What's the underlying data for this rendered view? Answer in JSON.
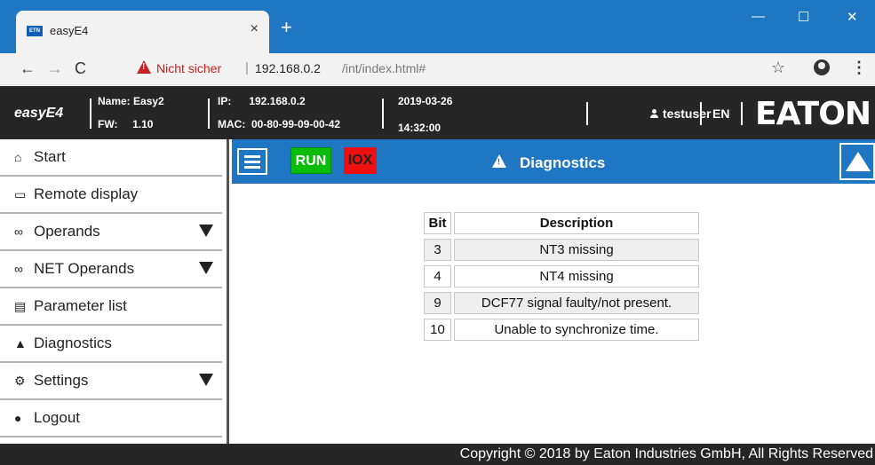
{
  "browser": {
    "tab_title": "easyE4",
    "tab_favicon_text": "ETN",
    "tab_close": "×",
    "new_tab": "+",
    "win_min": "—",
    "win_max": "☐",
    "win_close": "✕",
    "not_secure": "Nicht sicher",
    "url_host": "192.168.0.2",
    "url_path": "/int/index.html#",
    "back": "←",
    "forward": "→",
    "reload": "C",
    "star": "☆",
    "menu": "⋮"
  },
  "header": {
    "app_name": "easyE4",
    "name_label": "Name: Easy2",
    "fw_label": "FW:     1.10",
    "ip_label": "IP:      192.168.0.2",
    "mac_label": "MAC:  00-80-99-09-00-42",
    "date": "2019-03-26",
    "time": "14:32:00",
    "user": "testuser",
    "language": "EN",
    "brand": "EATON"
  },
  "sidebar": {
    "items": [
      {
        "label": "Start",
        "icon": "home-icon",
        "glyph": "⌂",
        "has_submenu": false
      },
      {
        "label": "Remote display",
        "icon": "monitor-icon",
        "glyph": "▭",
        "has_submenu": false
      },
      {
        "label": "Operands",
        "icon": "glasses-icon",
        "glyph": "∞",
        "has_submenu": true
      },
      {
        "label": "NET Operands",
        "icon": "glasses-icon",
        "glyph": "∞",
        "has_submenu": true
      },
      {
        "label": "Parameter list",
        "icon": "list-icon",
        "glyph": "▤",
        "has_submenu": false
      },
      {
        "label": "Diagnostics",
        "icon": "warning-icon",
        "glyph": "▲",
        "has_submenu": false
      },
      {
        "label": "Settings",
        "icon": "gear-icon",
        "glyph": "⚙",
        "has_submenu": true
      },
      {
        "label": "Logout",
        "icon": "user-icon",
        "glyph": "●",
        "has_submenu": false
      }
    ]
  },
  "toolbar": {
    "run": "RUN",
    "iox": "IOX",
    "title": "Diagnostics",
    "colors": {
      "accent": "#1f76c2",
      "run": "#0bbd0b",
      "iox": "#ee1010"
    }
  },
  "table": {
    "headers": {
      "bit": "Bit",
      "description": "Description"
    },
    "rows": [
      {
        "bit": "3",
        "description": "NT3 missing"
      },
      {
        "bit": "4",
        "description": "NT4 missing"
      },
      {
        "bit": "9",
        "description": "DCF77 signal faulty/not present."
      },
      {
        "bit": "10",
        "description": "Unable to synchronize time."
      }
    ]
  },
  "footer": {
    "copyright": "Copyright © 2018 by Eaton Industries GmbH, All Rights Reserved"
  }
}
